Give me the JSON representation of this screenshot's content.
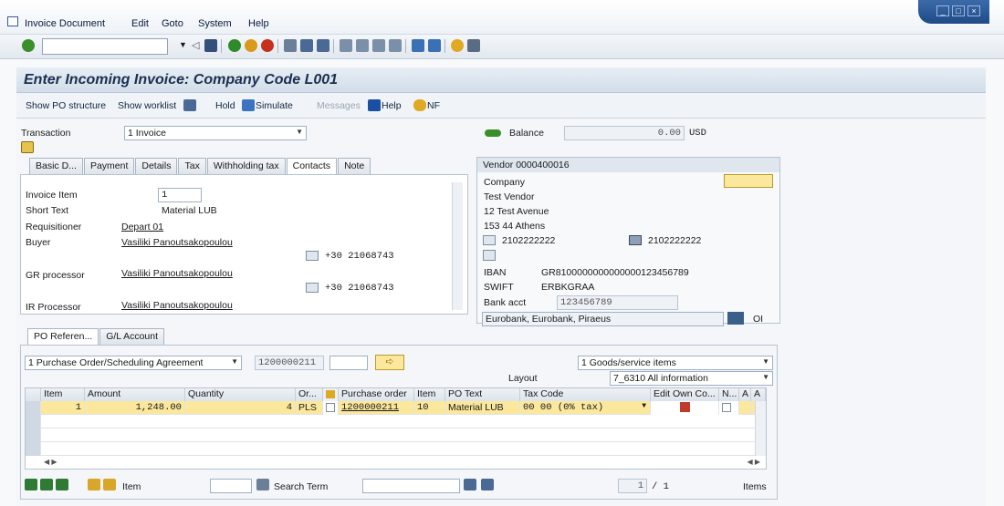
{
  "menu": {
    "items": [
      "Invoice Document",
      "Edit",
      "Goto",
      "System",
      "Help"
    ]
  },
  "title": "Enter Incoming Invoice: Company Code L001",
  "app_toolbar": {
    "show_po_structure": "Show PO structure",
    "show_worklist": "Show worklist",
    "hold": "Hold",
    "simulate": "Simulate",
    "messages": "Messages",
    "help": "Help",
    "nf": "NF"
  },
  "header": {
    "transaction_label": "Transaction",
    "transaction_value": "1 Invoice",
    "balance_label": "Balance",
    "balance_value": "0.00",
    "balance_currency": "USD"
  },
  "tabs": [
    "Basic D...",
    "Payment",
    "Details",
    "Tax",
    "Withholding tax",
    "Contacts",
    "Note"
  ],
  "active_tab": "Contacts",
  "contacts": {
    "invoice_item_label": "Invoice Item",
    "invoice_item_value": "1",
    "short_text_label": "Short Text",
    "short_text_value": "Material LUB",
    "requisitioner_label": "Requisitioner",
    "requisitioner_value": "Depart 01",
    "buyer_label": "Buyer",
    "buyer_value": "Vasiliki Panoutsakopoulou",
    "buyer_phone": "+30 21068743",
    "gr_label": "GR processor",
    "gr_value": "Vasiliki Panoutsakopoulou",
    "gr_phone": "+30 21068743",
    "ir_label": "IR Processor",
    "ir_value": "Vasiliki Panoutsakopoulou"
  },
  "vendor": {
    "title": "Vendor 0000400016",
    "company": "Company",
    "name": "Test Vendor",
    "street": "12 Test Avenue",
    "city": "153 44 Athens",
    "phone": "2102222222",
    "fax": "2102222222",
    "iban_label": "IBAN",
    "iban_value": "GR8100000000000000123456789",
    "swift_label": "SWIFT",
    "swift_value": "ERBKGRAA",
    "bank_acct_label": "Bank acct",
    "bank_acct_value": "123456789",
    "bank_name": "Eurobank, Eurobank, Piraeus",
    "oi_label": "OI"
  },
  "po_tabs": [
    "PO Referen...",
    "G/L Account"
  ],
  "po_ref": {
    "ref_type": "1 Purchase Order/Scheduling Agreement",
    "po_number": "1200000211",
    "item_type": "1 Goods/service items",
    "layout_label": "Layout",
    "layout_value": "7_6310 All information"
  },
  "grid": {
    "headers": [
      "Item",
      "Amount",
      "Quantity",
      "Or...",
      "",
      "Purchase order",
      "Item",
      "PO Text",
      "Tax Code",
      "Edit Own Co...",
      "N...",
      "A",
      "A"
    ],
    "rows": [
      {
        "item": "1",
        "amount": "1,248.00",
        "quantity": "4",
        "uom": "PLS",
        "po": "1200000211",
        "po_item": "10",
        "po_text": "Material LUB",
        "tax_code": "00 00 (0% tax)"
      }
    ]
  },
  "footer": {
    "item_label": "Item",
    "search_term_label": "Search Term",
    "page_value": "1",
    "page_total": "/ 1",
    "items_label": "Items"
  },
  "colors": {
    "selected_row": "#fce89c",
    "title_blue": "#1b2f4f",
    "accent_yellow": "#f4c430"
  }
}
